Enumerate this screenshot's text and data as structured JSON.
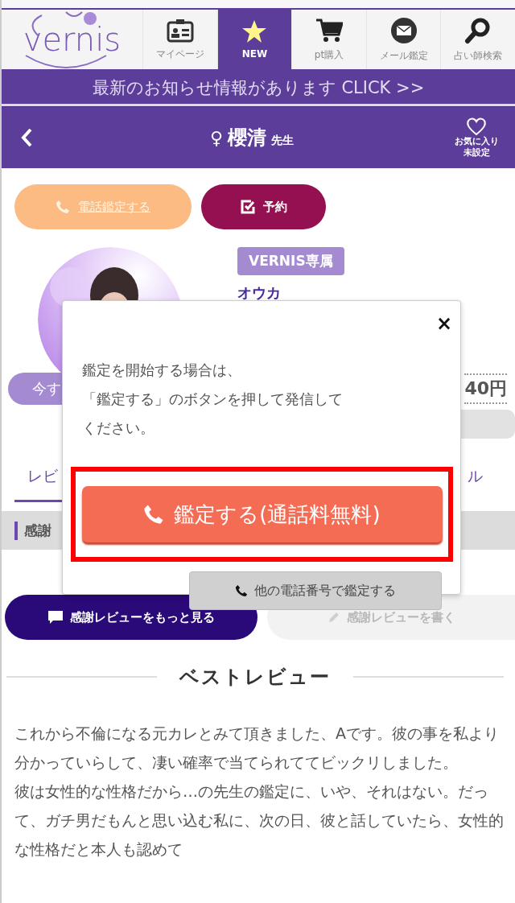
{
  "logo": {
    "text": "vernis"
  },
  "nav": [
    {
      "label": "マイページ",
      "selected": false
    },
    {
      "label": "NEW",
      "selected": true
    },
    {
      "label": "pt購入",
      "selected": false
    },
    {
      "label": "メール鑑定",
      "selected": false
    },
    {
      "label": "占い師検索",
      "selected": false
    }
  ],
  "news_bar": "最新のお知らせ情報があります CLICK >>",
  "title_bar": {
    "gender_symbol": "♀",
    "name": "櫻清",
    "suffix": "先生",
    "favorite": [
      "お気に入り",
      "未設定"
    ]
  },
  "actions": [
    {
      "label": "電話鑑定する",
      "kind": "phone"
    },
    {
      "label": "予約",
      "kind": "reserve"
    }
  ],
  "profile": {
    "badge": "VERNIS専属",
    "name": "オウカ",
    "status_pill": "今す",
    "price": "40円"
  },
  "tabs": [
    {
      "label": "レビ",
      "selected": true
    },
    {
      "label": "ル",
      "selected": false
    }
  ],
  "section_bar": "感謝",
  "review_buttons": [
    {
      "label": "感謝レビューをもっと見る",
      "kind": "more"
    },
    {
      "label": "感謝レビューを書く",
      "kind": "write"
    }
  ],
  "best_review": {
    "heading": "ベストレビュー",
    "paragraphs": [
      "これから不倫になる元カレとみて頂きました、Aです。彼の事を私より分かっていらして、凄い確率で当てられててビックリしました。",
      "彼は女性的な性格だから…の先生の鑑定に、いや、それはない。だって、ガチ男だもんと思い込む私に、次の日、彼と話していたら、女性的な性格だと本人も認めて"
    ]
  },
  "modal": {
    "close": "×",
    "message": [
      "鑑定を開始する場合は、",
      "「鑑定する」のボタンを押して発信して",
      "ください。"
    ],
    "primary": "鑑定する(通話料無料)",
    "primary_highlighted": true,
    "secondary": "他の電話番号で鑑定する"
  }
}
